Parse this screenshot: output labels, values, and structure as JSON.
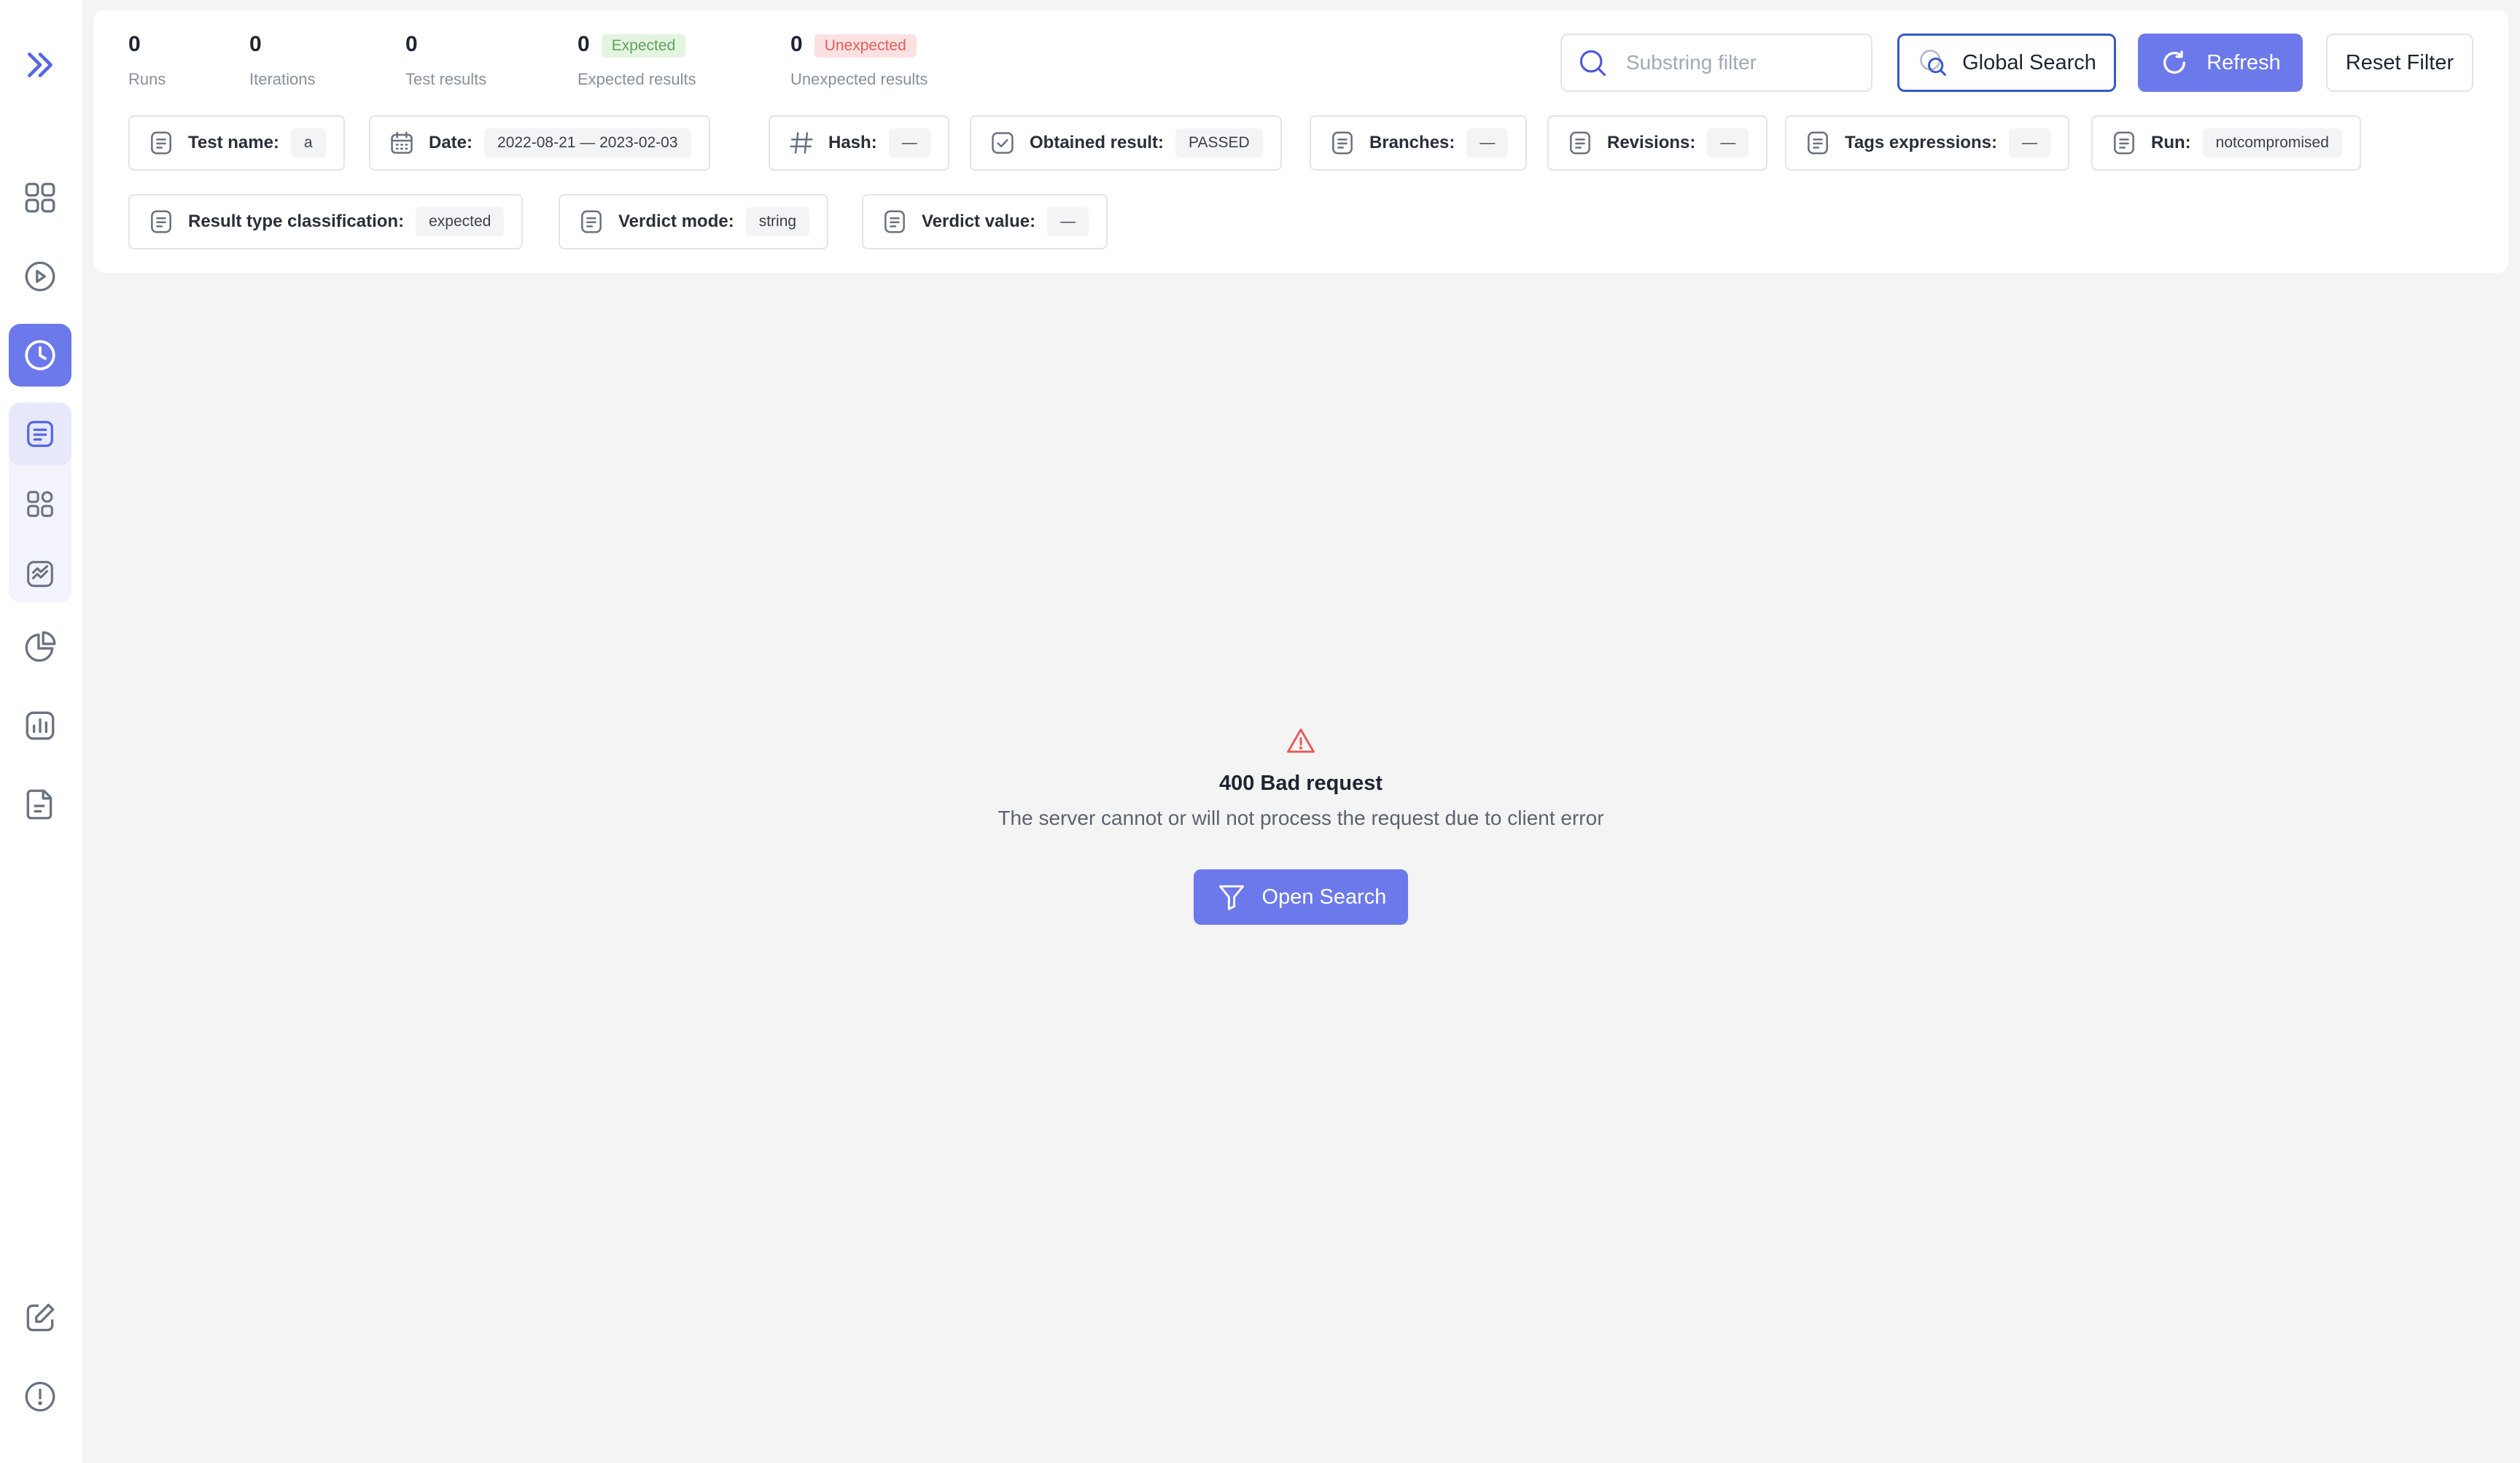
{
  "sidebar": {
    "items": [
      {
        "icon": "expand-chevrons-icon"
      },
      {
        "icon": "dashboard-grid-icon"
      },
      {
        "icon": "play-circle-icon"
      },
      {
        "icon": "history-clock-icon",
        "active": true
      },
      {
        "icon": "log-list-icon",
        "selected": true
      },
      {
        "icon": "components-icon"
      },
      {
        "icon": "trend-chart-icon"
      },
      {
        "icon": "pie-chart-icon"
      },
      {
        "icon": "bar-chart-icon"
      },
      {
        "icon": "report-document-icon"
      },
      {
        "icon": "edit-icon"
      },
      {
        "icon": "alert-info-icon"
      }
    ]
  },
  "stats": [
    {
      "value": "0",
      "label": "Runs"
    },
    {
      "value": "0",
      "label": "Iterations"
    },
    {
      "value": "0",
      "label": "Test results"
    },
    {
      "value": "0",
      "label": "Expected results",
      "badge": "Expected",
      "badge_color": "#62a25b"
    },
    {
      "value": "0",
      "label": "Unexpected results",
      "badge": "Unexpected",
      "badge_color": "#e25c5c"
    }
  ],
  "search": {
    "placeholder": "Substring filter"
  },
  "toolbar": {
    "global_search": "Global Search",
    "refresh": "Refresh",
    "reset_filter": "Reset Filter"
  },
  "filters": [
    {
      "label": "Test name:",
      "value": "a",
      "icon": "text-doc-icon"
    },
    {
      "label": "Date:",
      "value": "2022-08-21 — 2023-02-03",
      "icon": "calendar-icon"
    },
    {
      "label": "Hash:",
      "value": "—",
      "icon": "hash-icon"
    },
    {
      "label": "Obtained result:",
      "value": "PASSED",
      "icon": "checkbox-icon"
    },
    {
      "label": "Branches:",
      "value": "—",
      "icon": "text-doc-icon"
    },
    {
      "label": "Revisions:",
      "value": "—",
      "icon": "text-doc-icon"
    },
    {
      "label": "Tags expressions:",
      "value": "—",
      "icon": "text-doc-icon"
    },
    {
      "label": "Run:",
      "value": "notcompromised",
      "icon": "text-doc-icon"
    },
    {
      "label": "Result type classification:",
      "value": "expected",
      "icon": "text-doc-icon"
    },
    {
      "label": "Verdict mode:",
      "value": "string",
      "icon": "text-doc-icon"
    },
    {
      "label": "Verdict value:",
      "value": "—",
      "icon": "text-doc-icon"
    }
  ],
  "error": {
    "title": "400 Bad request",
    "message": "The server cannot or will not process the request due to client error",
    "button": "Open Search"
  },
  "colors": {
    "accent": "#6c79ea",
    "error": "#e25c5c",
    "global_search_border": "#3558c9"
  }
}
